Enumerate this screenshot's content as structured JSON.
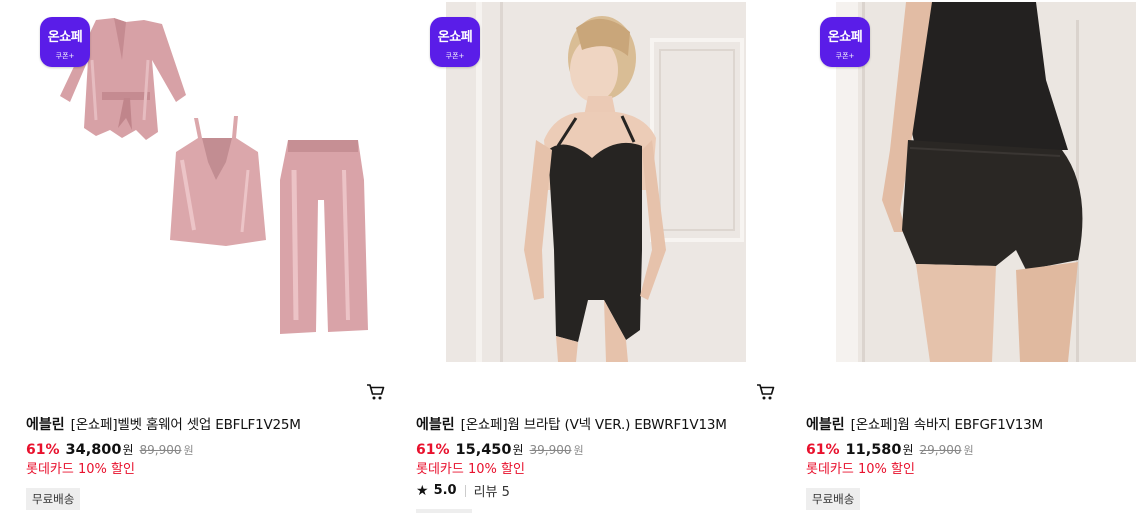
{
  "badge": {
    "main": "온쇼페",
    "sub": "쿠폰+"
  },
  "products": [
    {
      "brand": "에블린",
      "name": "[온쇼페]벨벳 홈웨어 셋업 EBFLF1V25M",
      "discount": "61%",
      "price": "34,800",
      "currency": "원",
      "original_price": "89,900",
      "card_note": "롯데카드 10% 할인",
      "shipping_tag": "무료배송",
      "image_desc": "pink-velvet-homewear-set"
    },
    {
      "brand": "에블린",
      "name": "[온쇼페]웜 브라탑 (V넥 VER.) EBWRF1V13M",
      "discount": "61%",
      "price": "15,450",
      "currency": "원",
      "original_price": "39,900",
      "card_note": "롯데카드 10% 할인",
      "rating": "5.0",
      "review_label": "리뷰 5",
      "image_desc": "model-black-bra-top"
    },
    {
      "brand": "에블린",
      "name": "[온쇼페]웜 속바지 EBFGF1V13M",
      "discount": "61%",
      "price": "11,580",
      "currency": "원",
      "original_price": "29,900",
      "card_note": "롯데카드 10% 할인",
      "shipping_tag": "무료배송",
      "image_desc": "model-black-shorts"
    }
  ],
  "colors": {
    "badge": "#5a1de8",
    "discount": "#e8112d",
    "pink": "#d9a3a8",
    "black": "#262422"
  }
}
